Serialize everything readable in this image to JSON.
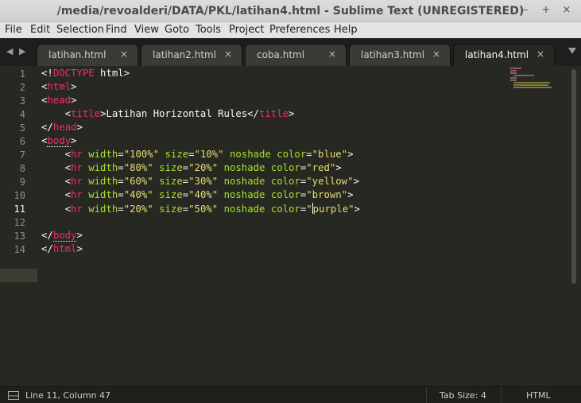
{
  "window": {
    "title": "/media/revoalderi/DATA/PKL/latihan4.html - Sublime Text (UNREGISTERED)",
    "minimize_glyph": "–",
    "maximize_glyph": "+",
    "close_glyph": "×"
  },
  "menu": [
    "File",
    "Edit",
    "Selection",
    "Find",
    "View",
    "Goto",
    "Tools",
    "Project",
    "Preferences",
    "Help"
  ],
  "tabs": [
    {
      "label": "latihan.html",
      "close": "×",
      "active": false
    },
    {
      "label": "latihan2.html",
      "close": "×",
      "active": false
    },
    {
      "label": "coba.html",
      "close": "×",
      "active": false
    },
    {
      "label": "latihan3.html",
      "close": "×",
      "active": false
    },
    {
      "label": "latihan4.html",
      "close": "×",
      "active": true
    }
  ],
  "tabnav": {
    "prev": "◀",
    "next": "▶"
  },
  "line_numbers": [
    "1",
    "2",
    "3",
    "4",
    "5",
    "6",
    "7",
    "8",
    "9",
    "10",
    "11",
    "12",
    "13",
    "14"
  ],
  "current_line": "11",
  "status": {
    "position": "Line 11, Column 47",
    "tab_size": "Tab Size: 4",
    "syntax": "HTML"
  },
  "colors": {
    "background": "#272822",
    "tag": "#f92672",
    "attribute": "#a6e22e",
    "string": "#e6db74",
    "text": "#f8f8f2"
  }
}
